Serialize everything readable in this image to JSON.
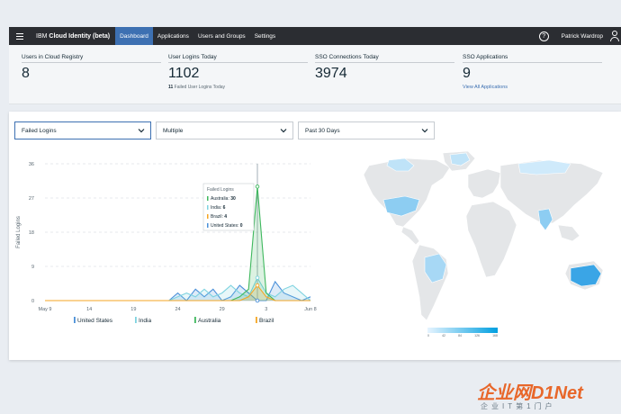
{
  "nav": {
    "brand_prefix": "IBM ",
    "brand_bold": "Cloud Identity (beta)",
    "tabs": [
      {
        "label": "Dashboard",
        "active": true
      },
      {
        "label": "Applications",
        "active": false
      },
      {
        "label": "Users and Groups",
        "active": false
      },
      {
        "label": "Settings",
        "active": false
      }
    ],
    "help_glyph": "?",
    "user_name": "Patrick Wardrop"
  },
  "stats": [
    {
      "label": "Users in Cloud Registry",
      "value": "8"
    },
    {
      "label": "User Logins Today",
      "value": "1102",
      "sub_count": "11",
      "sub_text": " Failed User Logins Today"
    },
    {
      "label": "SSO Connections Today",
      "value": "3974"
    },
    {
      "label": "SSO Applications",
      "value": "9",
      "link": "View All Applications"
    }
  ],
  "filters": {
    "metric": "Failed Logins",
    "scope": "Multiple",
    "range": "Past 30 Days"
  },
  "tooltip": {
    "title": "Failed Logins",
    "rows": [
      {
        "label": "Australia: ",
        "value": "30"
      },
      {
        "label": "India: ",
        "value": "6"
      },
      {
        "label": "Brazil: ",
        "value": "4"
      },
      {
        "label": "United States: ",
        "value": "0"
      }
    ]
  },
  "colors": {
    "accent": "#3d70b2",
    "united_states": "#4a90d9",
    "india": "#7fd3e0",
    "australia": "#3fb85e",
    "brazil": "#f5a623"
  },
  "chart_data": {
    "type": "line",
    "ylabel": "Failed Logins",
    "ylim": [
      0,
      36
    ],
    "yticks": [
      "0",
      "9",
      "18",
      "27",
      "36"
    ],
    "xtick_labels": [
      "May 9",
      "14",
      "19",
      "24",
      "29",
      "3",
      "Jun 8"
    ],
    "x_days": 31,
    "xtick_days": [
      0,
      5,
      10,
      15,
      20,
      25,
      30
    ],
    "hover_day": 24,
    "series": [
      {
        "name": "United States",
        "color": "#4a90d9",
        "values": [
          0,
          0,
          0,
          0,
          0,
          0,
          0,
          0,
          0,
          0,
          0,
          0,
          0,
          0,
          0,
          2,
          0,
          3,
          1,
          3,
          0,
          1,
          4,
          2,
          0,
          0,
          5,
          2,
          1,
          0,
          1
        ]
      },
      {
        "name": "India",
        "color": "#7fd3e0",
        "values": [
          0,
          0,
          0,
          0,
          0,
          0,
          0,
          0,
          0,
          0,
          0,
          0,
          0,
          0,
          0,
          1,
          2,
          1,
          3,
          1,
          2,
          4,
          2,
          1,
          6,
          2,
          1,
          3,
          4,
          2,
          0
        ]
      },
      {
        "name": "Australia",
        "color": "#3fb85e",
        "values": [
          0,
          0,
          0,
          0,
          0,
          0,
          0,
          0,
          0,
          0,
          0,
          0,
          0,
          0,
          0,
          0,
          0,
          0,
          0,
          0,
          0,
          0,
          1,
          3,
          30,
          2,
          0,
          0,
          0,
          0,
          0
        ]
      },
      {
        "name": "Brazil",
        "color": "#f5a623",
        "values": [
          0,
          0,
          0,
          0,
          0,
          0,
          0,
          0,
          0,
          0,
          0,
          0,
          0,
          0,
          0,
          0,
          0,
          0,
          0,
          0,
          0,
          0,
          0,
          1,
          4,
          1,
          0,
          0,
          0,
          0,
          0
        ]
      }
    ]
  },
  "map": {
    "scale_labels": [
      "0",
      "42",
      "84",
      "126",
      "168"
    ]
  },
  "watermark": {
    "main": "企业网D1Net",
    "sub": "企业IT第1门户"
  }
}
